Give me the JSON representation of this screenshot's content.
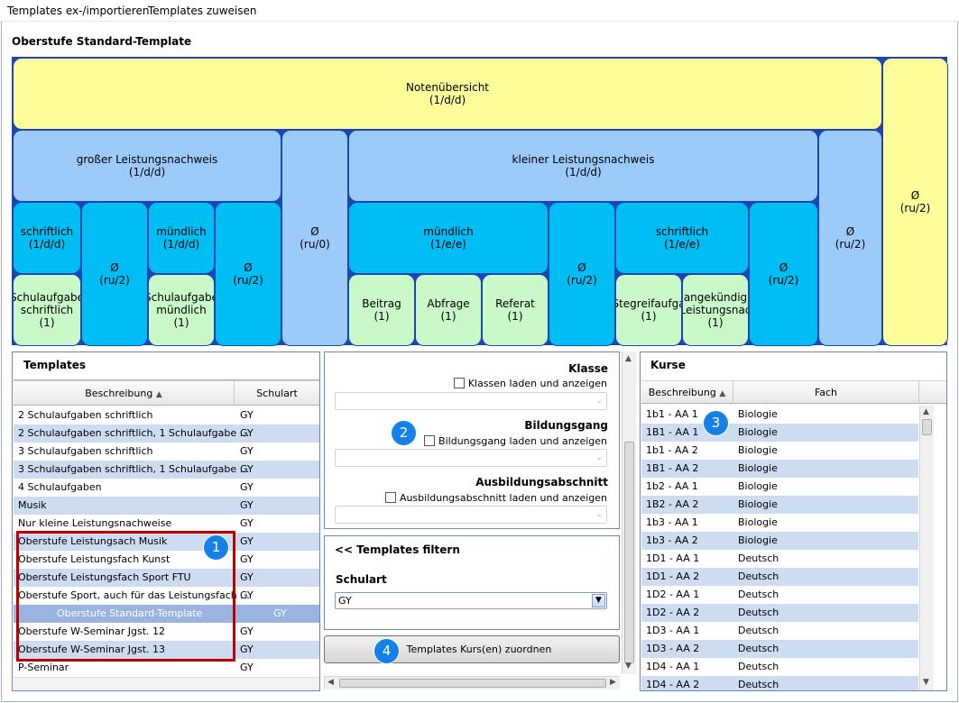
{
  "menu": {
    "items": [
      "Templates ex-/importieren",
      "Templates zuweisen"
    ]
  },
  "template_title": "Oberstufe Standard-Template",
  "tree": {
    "noten": {
      "title": "Notenübersicht",
      "sub": "(1/d/d)"
    },
    "gross": {
      "title": "großer Leistungsnachweis",
      "sub": "(1/d/d)"
    },
    "klein": {
      "title": "kleiner Leistungsnachweis",
      "sub": "(1/d/d)"
    },
    "gross_schriftlich": {
      "title": "schriftlich",
      "sub": "(1/d/d)"
    },
    "gross_avg1": {
      "title": "Ø",
      "sub": "(ru/2)"
    },
    "gross_muendlich": {
      "title": "mündlich",
      "sub": "(1/d/d)"
    },
    "gross_avg2": {
      "title": "Ø",
      "sub": "(ru/2)"
    },
    "avg_ru0": {
      "title": "Ø",
      "sub": "(ru/0)"
    },
    "klein_muendlich": {
      "title": "mündlich",
      "sub": "(1/e/e)"
    },
    "klein_avg1": {
      "title": "Ø",
      "sub": "(ru/2)"
    },
    "klein_schriftlich": {
      "title": "schriftlich",
      "sub": "(1/e/e)"
    },
    "klein_avg2": {
      "title": "Ø",
      "sub": "(ru/2)"
    },
    "avg_right": {
      "title": "Ø",
      "sub": "(ru/2)"
    },
    "avg_total": {
      "title": "Ø",
      "sub": "(ru/2)"
    },
    "sa_schriftlich": {
      "l1": "Schulaufgabe",
      "l2": "schriftlich",
      "l3": "(1)"
    },
    "sa_muendlich": {
      "l1": "Schulaufgabe",
      "l2": "mündlich",
      "l3": "(1)"
    },
    "beitrag": {
      "l1": "Beitrag",
      "l2": "(1)"
    },
    "abfrage": {
      "l1": "Abfrage",
      "l2": "(1)"
    },
    "referat": {
      "l1": "Referat",
      "l2": "(1)"
    },
    "stegreif": {
      "l1": "Stegreifaufga",
      "l2": "(1)"
    },
    "angekuendigt": {
      "l1": "angekündig",
      "l2": "Leistungsnac",
      "l3": "(1)"
    }
  },
  "templates": {
    "title": "Templates",
    "col_beschreibung": "Beschreibung",
    "col_schulart": "Schulart",
    "rows": [
      {
        "name": "2 Schulaufgaben schriftlich",
        "schulart": "GY"
      },
      {
        "name": "2 Schulaufgaben schriftlich, 1 Schulaufgabe ...",
        "schulart": "GY"
      },
      {
        "name": "3 Schulaufgaben schriftlich",
        "schulart": "GY"
      },
      {
        "name": "3 Schulaufgaben schriftlich, 1 Schulaufgabe ...",
        "schulart": "GY"
      },
      {
        "name": "4 Schulaufgaben",
        "schulart": "GY"
      },
      {
        "name": "Musik",
        "schulart": "GY"
      },
      {
        "name": "Nur kleine Leistungsnachweise",
        "schulart": "GY"
      },
      {
        "name": "Oberstufe Leistungsach Musik",
        "schulart": "GY"
      },
      {
        "name": "Oberstufe Leistungsfach Kunst",
        "schulart": "GY"
      },
      {
        "name": "Oberstufe Leistungsfach Sport FTU",
        "schulart": "GY"
      },
      {
        "name": "Oberstufe Sport, auch für das Leistungsfach ...",
        "schulart": "GY"
      },
      {
        "name": "Oberstufe Standard-Template",
        "schulart": "GY"
      },
      {
        "name": "Oberstufe W-Seminar Jgst. 12",
        "schulart": "GY"
      },
      {
        "name": "Oberstufe W-Seminar Jgst. 13",
        "schulart": "GY"
      },
      {
        "name": "P-Seminar",
        "schulart": "GY"
      }
    ]
  },
  "filters": {
    "klasse": {
      "label": "Klasse",
      "check": "Klassen laden und anzeigen"
    },
    "bildungsgang": {
      "label": "Bildungsgang",
      "check": "Bildungsgang laden und anzeigen"
    },
    "ausbildung": {
      "label": "Ausbildungsabschnitt",
      "check": "Ausbildungsabschnitt laden und anzeigen"
    },
    "filter_title": "<< Templates filtern",
    "schulart_label": "Schulart",
    "schulart_value": "GY",
    "assign_button": "Templates Kurs(en) zuordnen"
  },
  "kurse": {
    "title": "Kurse",
    "col_beschreibung": "Beschreibung",
    "col_fach": "Fach",
    "rows": [
      {
        "name": "1b1 - AA 1",
        "fach": "Biologie"
      },
      {
        "name": "1B1 - AA 1",
        "fach": "Biologie"
      },
      {
        "name": "1b1 - AA 2",
        "fach": "Biologie"
      },
      {
        "name": "1B1 - AA 2",
        "fach": "Biologie"
      },
      {
        "name": "1b2 - AA 1",
        "fach": "Biologie"
      },
      {
        "name": "1B2 - AA 2",
        "fach": "Biologie"
      },
      {
        "name": "1b3 - AA 1",
        "fach": "Biologie"
      },
      {
        "name": "1b3 - AA 2",
        "fach": "Biologie"
      },
      {
        "name": "1D1 - AA 1",
        "fach": "Deutsch"
      },
      {
        "name": "1D1 - AA 2",
        "fach": "Deutsch"
      },
      {
        "name": "1D2 - AA 1",
        "fach": "Deutsch"
      },
      {
        "name": "1D2 - AA 2",
        "fach": "Deutsch"
      },
      {
        "name": "1D3 - AA 1",
        "fach": "Deutsch"
      },
      {
        "name": "1D3 - AA 2",
        "fach": "Deutsch"
      },
      {
        "name": "1D4 - AA 1",
        "fach": "Deutsch"
      },
      {
        "name": "1D4 - AA 2",
        "fach": "Deutsch"
      }
    ]
  },
  "badges": [
    "1",
    "2",
    "3",
    "4"
  ],
  "colors": {
    "selected_row": "#99b4e3",
    "alt_row": "#cddcf1",
    "highlight_border": "#c00000",
    "badge": "#1581e8"
  }
}
